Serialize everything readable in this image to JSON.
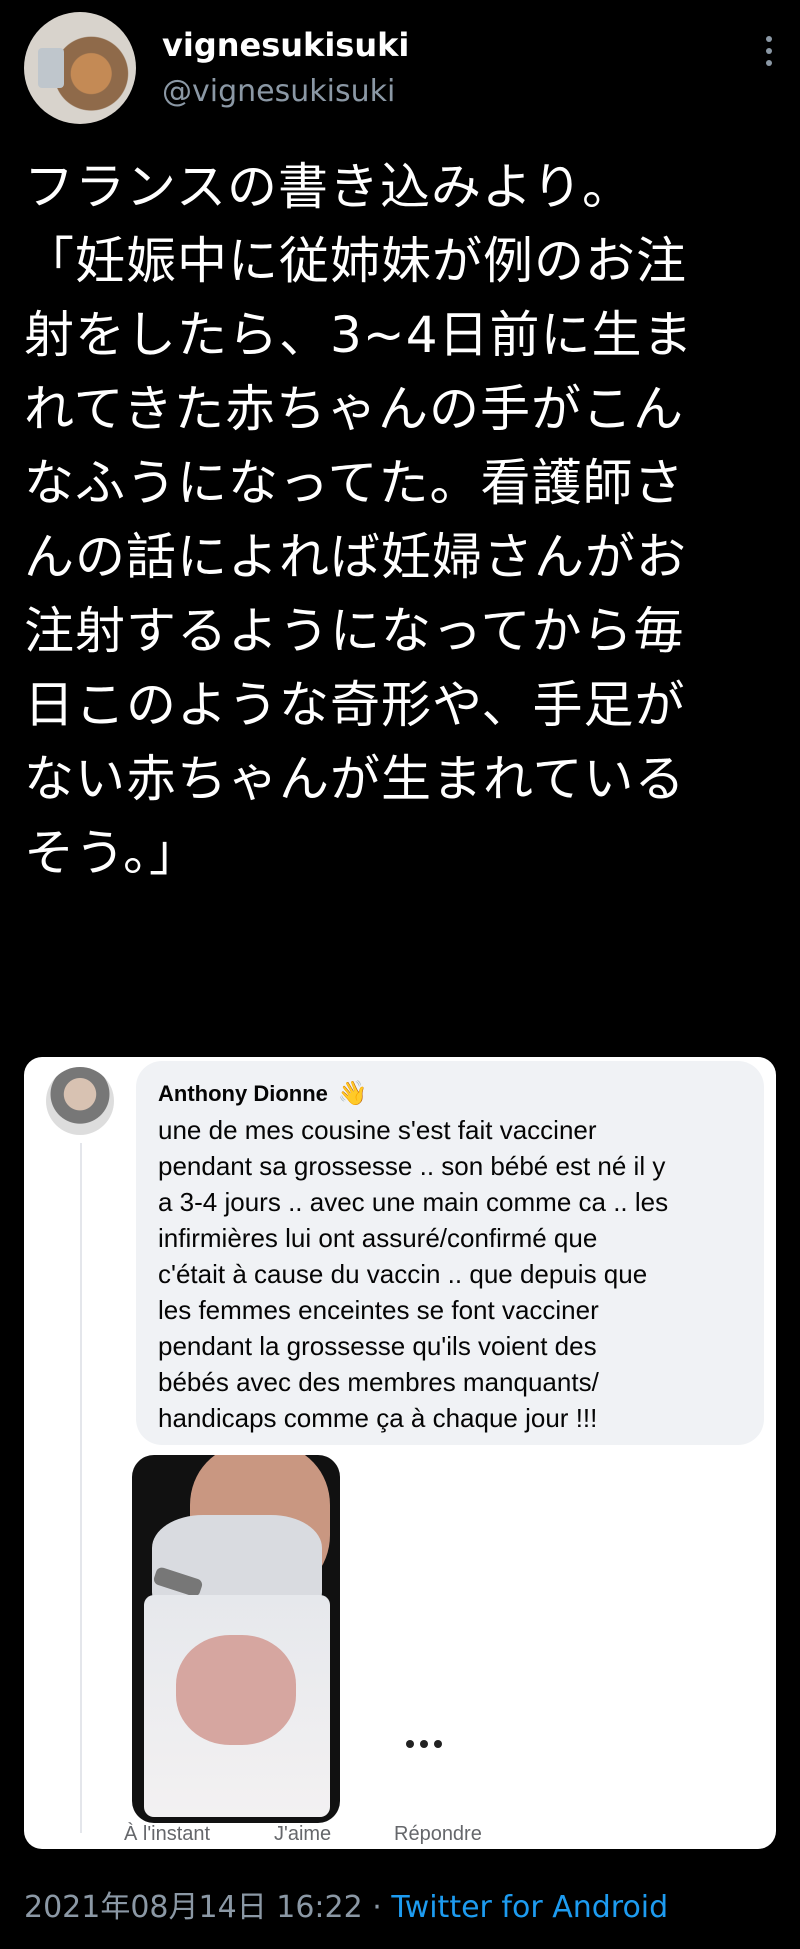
{
  "author": {
    "display_name": "vignesukisuki",
    "handle": "@vignesukisuki"
  },
  "tweet": {
    "text": "フランスの書き込みより。\n「妊娠中に従姉妹が例のお注\n射をしたら、3~4日前に生ま\nれてきた赤ちゃんの手がこん\nなふうになってた。看護師さ\nんの話によれば妊婦さんがお\n注射するようになってから毎\n日このような奇形や、手足が\nない赤ちゃんが生まれている\nそう。」"
  },
  "embedded_comment": {
    "author": "Anthony Dionne",
    "text": "une de mes cousine s'est fait vacciner\npendant sa grossesse .. son bébé est né il y\na 3-4 jours .. avec une main comme ca .. les\ninfirmières lui ont assuré/confirmé que\nc'était à cause du vaccin .. que depuis que\nles femmes enceintes se font vacciner\npendant la grossesse qu'ils voient des\nbébés avec des membres manquants/\nhandicaps comme ça à chaque jour !!!",
    "actions": {
      "time": "À l'instant",
      "like": "J'aime",
      "reply": "Répondre"
    }
  },
  "footer": {
    "timestamp": "2021年08月14日 16:22",
    "separator": "·",
    "source": "Twitter for Android"
  },
  "colors": {
    "background": "#000000",
    "handle_gray": "#8b98a5",
    "link_blue": "#1d9bf0"
  },
  "icons": [
    "avatar-photo",
    "more-options-icon",
    "waving-hand-icon",
    "ellipsis-icon"
  ]
}
